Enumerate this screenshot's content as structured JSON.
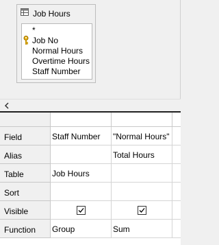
{
  "table": {
    "title": "Job Hours",
    "fields": [
      "*",
      "Job No",
      "Normal Hours",
      "Overtime Hours",
      "Staff Number"
    ],
    "key_field": "Job No"
  },
  "grid": {
    "row_labels": [
      "Field",
      "Alias",
      "Table",
      "Sort",
      "Visible",
      "Function"
    ],
    "columns": [
      {
        "field": "Staff Number",
        "alias": "",
        "table": "Job Hours",
        "sort": "",
        "visible": true,
        "function": "Group"
      },
      {
        "field": "\"Normal Hours\"",
        "alias": "Total Hours",
        "table": "",
        "sort": "",
        "visible": true,
        "function": "Sum"
      }
    ]
  }
}
